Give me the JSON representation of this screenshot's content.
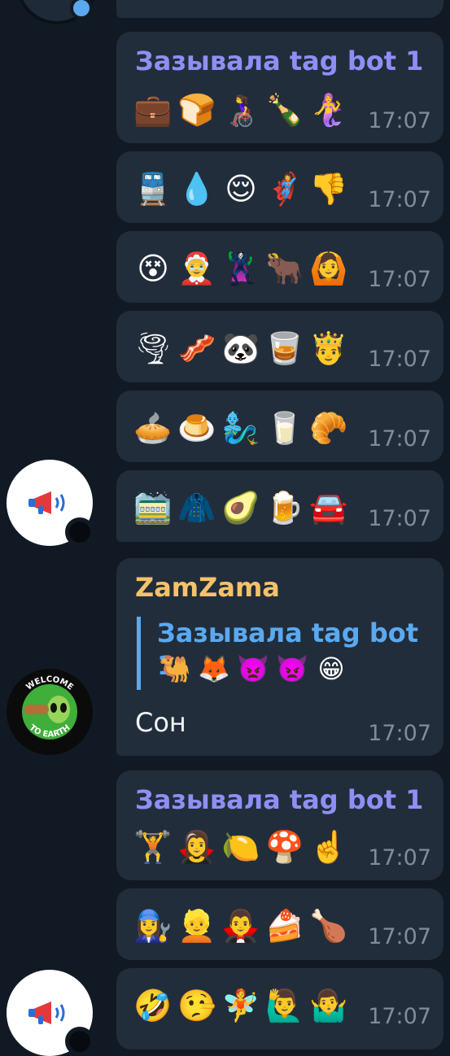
{
  "colors": {
    "background": "#111a24",
    "bubble": "#222d3b",
    "bot_name": "#8e8ff5",
    "zamzama_name": "#f5c26a",
    "reply_accent": "#5aa9f0",
    "time": "#7f8c9c"
  },
  "messages": [
    {
      "sender": "Зазывала tag bot 1",
      "emojis": [
        "💼",
        "🍞",
        "👩‍🦽",
        "🍾",
        "🧜‍♀️"
      ],
      "time": "17:07"
    },
    {
      "emojis": [
        "🚆",
        "💧",
        "😌",
        "🦸‍♀️",
        "👎"
      ],
      "time": "17:07"
    },
    {
      "emojis": [
        "😵",
        "🤶",
        "🦹‍♀️",
        "🐂",
        "🙆"
      ],
      "time": "17:07"
    },
    {
      "emojis": [
        "🌪",
        "🥓",
        "🐼",
        "🥃",
        "🤴"
      ],
      "time": "17:07"
    },
    {
      "emojis": [
        "🥧",
        "🍮",
        "🧞‍♂️",
        "🥛",
        "🥐"
      ],
      "time": "17:07"
    },
    {
      "emojis": [
        "🚞",
        "🧥",
        "🥑",
        "🍺",
        "🚘"
      ],
      "time": "17:07"
    },
    {
      "sender": "ZamZama",
      "reply": {
        "sender": "Зазывала tag bot 1",
        "emojis": [
          "🐫",
          "🦊",
          "👿",
          "👿",
          "😁"
        ]
      },
      "text": "Сон",
      "time": "17:07"
    },
    {
      "sender": "Зазывала tag bot 1",
      "emojis": [
        "🏋️",
        "🧛‍♀️",
        "🍋",
        "🍄",
        "☝️"
      ],
      "time": "17:07"
    },
    {
      "emojis": [
        "👩‍🔧",
        "👱",
        "🧛‍♂️",
        "🍰",
        "🍗"
      ],
      "time": "17:07"
    },
    {
      "emojis": [
        "🤣",
        "🤥",
        "🧚",
        "🙋‍♂️",
        "🤷‍♂️"
      ],
      "time": "17:07"
    }
  ],
  "avatars": {
    "bot_icon": "megaphone-icon",
    "zamzama_badge": {
      "top_text": "WELCOME",
      "bottom_text": "TO EARTH"
    }
  }
}
